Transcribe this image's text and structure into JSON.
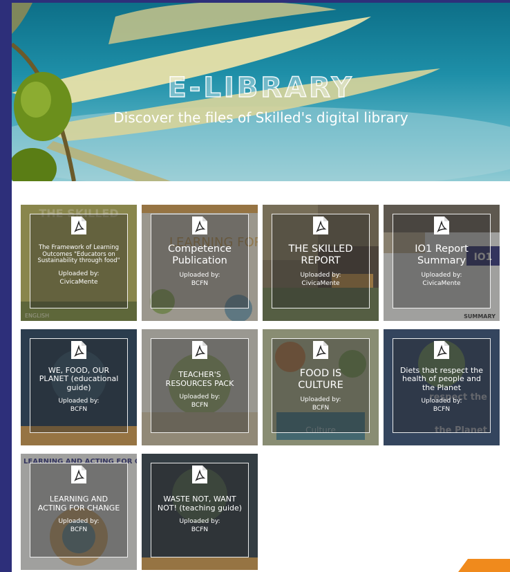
{
  "hero": {
    "title": "E-LIBRARY",
    "subtitle": "Discover the files of Skilled's digital library"
  },
  "cards": [
    {
      "title": "The Framework of Learning Outcomes \"Educators on Sustainability through food\"",
      "uploaded_label": "Uploaded by:",
      "uploader": "CivicaMente",
      "thumb_text": "THE SKILLED",
      "thumb_footer": "ENGLISH"
    },
    {
      "title": "Competence Publication",
      "uploaded_label": "Uploaded by:",
      "uploader": "BCFN",
      "thumb_text": "LEARNING FOR FUTURE"
    },
    {
      "title": "THE SKILLED REPORT",
      "uploaded_label": "Uploaded by:",
      "uploader": "CivicaMente"
    },
    {
      "title": "IO1 Report Summary",
      "uploaded_label": "Uploaded by:",
      "uploader": "CivicaMente",
      "thumb_text": "IO1",
      "thumb_footer": "SUMMARY"
    },
    {
      "title": "WE, FOOD, OUR PLANET (educational guide)",
      "uploaded_label": "Uploaded by:",
      "uploader": "BCFN"
    },
    {
      "title": "TEACHER'S RESOURCES PACK",
      "uploaded_label": "Uploaded by:",
      "uploader": "BCFN"
    },
    {
      "title": "FOOD IS CULTURE",
      "uploaded_label": "Uploaded by:",
      "uploader": "BCFN",
      "thumb_footer": "Culture"
    },
    {
      "title": "Diets that respect the health of people and the Planet",
      "uploaded_label": "Uploaded by:",
      "uploader": "BCFN",
      "thumb_text": "respect the",
      "thumb_footer": "the Planet"
    },
    {
      "title": "LEARNING AND ACTING FOR CHANGE",
      "uploaded_label": "Uploaded by:",
      "uploader": "BCFN",
      "thumb_text": "LEARNING AND ACTING FOR CHANGE"
    },
    {
      "title": "WASTE NOT, WANT NOT! (teaching guide)",
      "uploaded_label": "Uploaded by:",
      "uploader": "BCFN"
    }
  ],
  "colors": {
    "frame_border": "#2d2f7a",
    "accent": "#f08a1c"
  },
  "icons": {
    "card_icon": "pdf-file-icon"
  }
}
